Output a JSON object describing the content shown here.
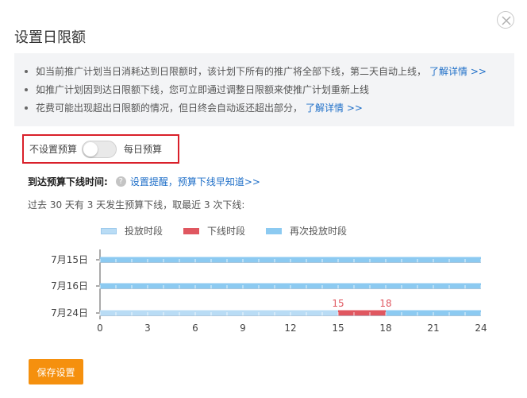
{
  "dialog": {
    "title": "设置日限额",
    "close_label": "close"
  },
  "notice": {
    "items": [
      {
        "text": "如当前推广计划当日消耗达到日限额时，该计划下所有的推广将全部下线，第二天自动上线，",
        "link": "了解详情 >>"
      },
      {
        "text": "如推广计划因到达日限额下线，您可立即通过调整日限额来使推广计划重新上线",
        "link": ""
      },
      {
        "text": "花费可能出现超出日限额的情况，但日终会自动返还超出部分，",
        "link": "了解详情 >>"
      }
    ]
  },
  "budget_toggle": {
    "left_label": "不设置预算",
    "right_label": "每日预算",
    "enabled": false
  },
  "offline_time": {
    "label": "到达预算下线时间:",
    "help_icon": "question-circle-icon",
    "link": "设置提醒，预算下线早知道>>"
  },
  "summary": "过去 30 天有 3 天发生预算下线，取最近 3 次下线:",
  "colors": {
    "active": "#b9dcf5",
    "offline": "#e05760",
    "again": "#8ccaf1",
    "accent": "#f5900e",
    "link": "#1f6fc8",
    "highlight_border": "#d9202a"
  },
  "legend": [
    {
      "label": "投放时段",
      "key": "active"
    },
    {
      "label": "下线时段",
      "key": "offline"
    },
    {
      "label": "再次投放时段",
      "key": "again"
    }
  ],
  "chart_data": {
    "type": "timeline",
    "xlim": [
      0,
      24
    ],
    "xticks": [
      0,
      3,
      6,
      9,
      12,
      15,
      18,
      21,
      24
    ],
    "rows": [
      {
        "label": "7月15日",
        "segments": [
          {
            "start": 0,
            "end": 24,
            "state": "again"
          }
        ]
      },
      {
        "label": "7月16日",
        "segments": [
          {
            "start": 0,
            "end": 24,
            "state": "again"
          }
        ]
      },
      {
        "label": "7月24日",
        "segments": [
          {
            "start": 0,
            "end": 15,
            "state": "active"
          },
          {
            "start": 15,
            "end": 18,
            "state": "offline"
          },
          {
            "start": 18,
            "end": 24,
            "state": "again"
          }
        ],
        "annotations": [
          {
            "x": 15,
            "text": "15"
          },
          {
            "x": 18,
            "text": "18"
          }
        ]
      }
    ]
  },
  "save_button": "保存设置"
}
